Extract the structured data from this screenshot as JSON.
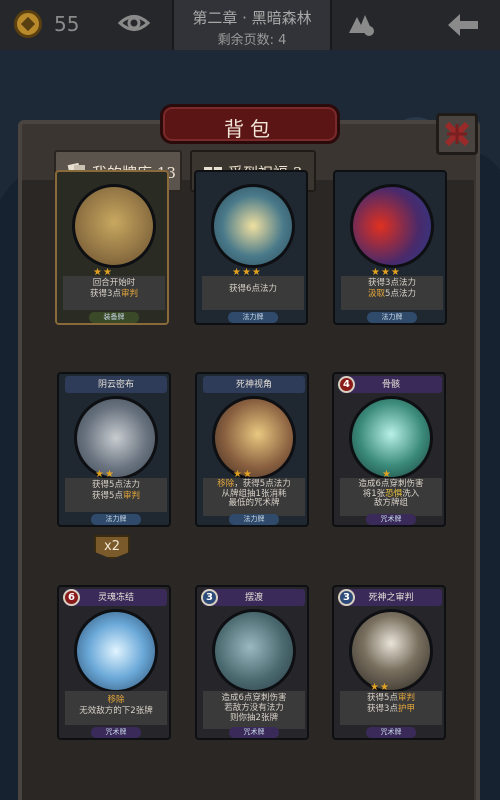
{
  "topbar": {
    "coin_count": "55",
    "chapter_title": "第二章 · 黑暗森林",
    "pages_left": "剩余页数: 4"
  },
  "panel": {
    "title": "背包",
    "tabs": [
      {
        "label": "我的牌库",
        "count": "13",
        "icon": "cards-icon"
      },
      {
        "label": "受到祝福",
        "count": "3",
        "icon": "gift-icon"
      }
    ]
  },
  "cards": [
    {
      "name": "",
      "cost": "",
      "stars": "★★",
      "desc": [
        "回合开始时",
        "获得3点",
        "审判"
      ],
      "type": "装备牌",
      "art": "scythe"
    },
    {
      "name": "",
      "cost": "",
      "stars": "★★★",
      "desc": [
        "获得6点法力"
      ],
      "type": "法力牌",
      "art": "swirl"
    },
    {
      "name": "",
      "cost": "",
      "stars": "★★★",
      "desc": [
        "获得3点法力",
        "汲取",
        "5点法力"
      ],
      "type": "法力牌",
      "art": "flame"
    },
    {
      "name": "阴云密布",
      "cost": "",
      "stars": "★★",
      "desc": [
        "获得5点法力",
        "获得5点",
        "审判"
      ],
      "type": "法力牌",
      "art": "clouds"
    },
    {
      "name": "死神视角",
      "cost": "",
      "stars": "★★",
      "desc": [
        "移除",
        "获得5点法力",
        "从牌组抽1张消耗",
        "最低的咒术牌"
      ],
      "type": "法力牌",
      "art": "reaper-view"
    },
    {
      "name": "骨骸",
      "cost": "4",
      "stars": "★",
      "desc": [
        "造成6点穿刺伤害",
        "将1张",
        "恐惧",
        "洗入",
        "敌方牌组"
      ],
      "type": "咒术牌",
      "art": "skeleton"
    },
    {
      "name": "灵魂冻结",
      "cost": "6",
      "stars": "",
      "desc": [
        "移除",
        "无效敌方的下2张牌"
      ],
      "type": "咒术牌",
      "art": "ice"
    },
    {
      "name": "摆渡",
      "cost": "3",
      "stars": "",
      "desc": [
        "造成6点穿刺伤害",
        "若敌方没有法力",
        "则你抽2张牌"
      ],
      "type": "咒术牌",
      "art": "ferry"
    },
    {
      "name": "死神之审判",
      "cost": "3",
      "stars": "★★",
      "desc": [
        "获得5点",
        "审判",
        "获得3点",
        "护甲"
      ],
      "type": "咒术牌",
      "art": "death"
    }
  ],
  "multiplier": "x2",
  "colors": {
    "accent_red": "#5b1515",
    "highlight": "#e6a83a",
    "panel": "#3a3530"
  }
}
